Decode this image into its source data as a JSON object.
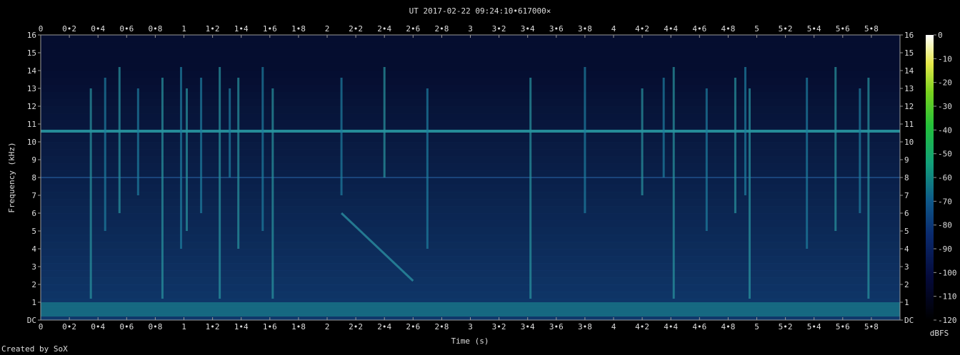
{
  "chart_data": {
    "type": "heatmap",
    "title": "UT 2017-02-22 09:24:10•617000×",
    "xlabel": "Time (s)",
    "ylabel": "Frequency (kHz)",
    "x_ticks": [
      "0",
      "0•2",
      "0•4",
      "0•6",
      "0•8",
      "1",
      "1•2",
      "1•4",
      "1•6",
      "1•8",
      "2",
      "2•2",
      "2•4",
      "2•6",
      "2•8",
      "3",
      "3•2",
      "3•4",
      "3•6",
      "3•8",
      "4",
      "4•2",
      "4•4",
      "4•6",
      "4•8",
      "5",
      "5•2",
      "5•4",
      "5•6",
      "5•8"
    ],
    "y_ticks": [
      "DC",
      "1",
      "2",
      "3",
      "4",
      "5",
      "6",
      "7",
      "8",
      "9",
      "10",
      "11",
      "12",
      "13",
      "14",
      "15",
      "16"
    ],
    "xlim": [
      0,
      6.0
    ],
    "ylim": [
      0,
      16
    ],
    "colorbar": {
      "label": "dBFS",
      "ticks": [
        "0",
        "-10",
        "-20",
        "-30",
        "-40",
        "-50",
        "-60",
        "-70",
        "-80",
        "-90",
        "-100",
        "-110",
        "-120"
      ],
      "range": [
        -120,
        0
      ]
    },
    "features": {
      "tone_khz": 10.6,
      "weak_tone_khz": 8.0,
      "low_band_khz": [
        0.2,
        1.0
      ],
      "sweep": {
        "t_start": 2.1,
        "f_start": 6.0,
        "t_end": 2.6,
        "f_end": 2.2
      },
      "transients_s": [
        0.35,
        0.45,
        0.55,
        0.68,
        0.85,
        0.98,
        1.02,
        1.12,
        1.25,
        1.32,
        1.38,
        1.55,
        1.62,
        2.1,
        2.4,
        2.7,
        3.42,
        3.8,
        4.2,
        4.35,
        4.42,
        4.65,
        4.85,
        4.92,
        4.95,
        5.35,
        5.55,
        5.72,
        5.78
      ]
    }
  },
  "footer": {
    "credit": "Created by SoX"
  }
}
